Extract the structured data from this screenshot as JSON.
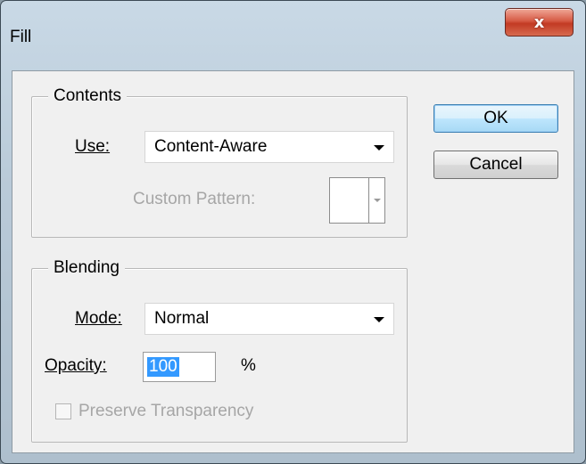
{
  "window": {
    "title": "Fill",
    "close_glyph": "x"
  },
  "contents": {
    "legend": "Contents",
    "use_label": "Use:",
    "use_value": "Content-Aware",
    "custom_pattern_label": "Custom Pattern:"
  },
  "blending": {
    "legend": "Blending",
    "mode_label": "Mode:",
    "mode_value": "Normal",
    "opacity_label": "Opacity:",
    "opacity_value": "100",
    "opacity_unit": "%",
    "preserve_label": "Preserve Transparency",
    "preserve_checked": false
  },
  "buttons": {
    "ok": "OK",
    "cancel": "Cancel"
  },
  "colors": {
    "selection": "#3399ff",
    "close_button": "#c23a23"
  },
  "icons": {
    "close": "close-icon",
    "dropdown": "chevron-down-icon"
  }
}
